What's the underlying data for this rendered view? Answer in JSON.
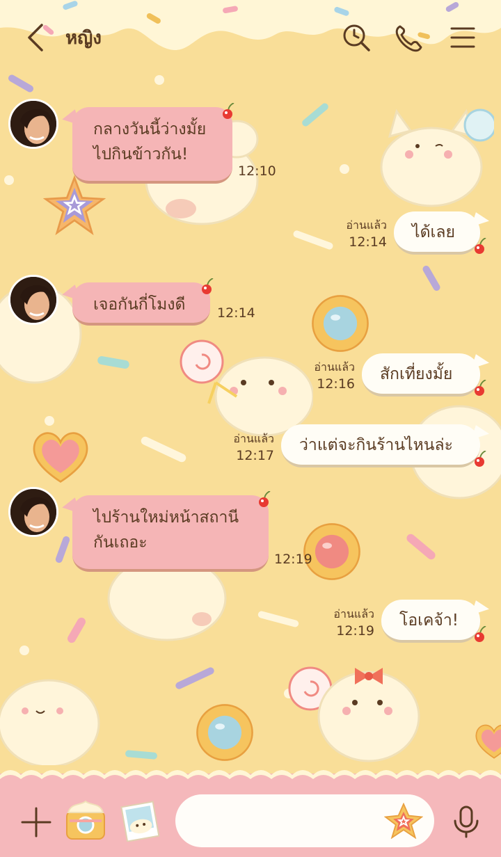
{
  "header": {
    "title": "หญิง"
  },
  "icons": {
    "back": "chevron-left-icon",
    "search": "search-clock-icon",
    "call": "phone-icon",
    "menu": "hamburger-menu-icon",
    "add": "plus-icon",
    "camera": "camera-icon",
    "gallery": "photo-icon",
    "sticker": "sticker-star-icon",
    "mic": "microphone-icon"
  },
  "colors": {
    "background": "#f9de98",
    "incoming_bubble": "#f5b5b6",
    "outgoing_bubble": "#fffdf6",
    "footer": "#f5b8bb",
    "text": "#5a3b22"
  },
  "messages": [
    {
      "from": "them",
      "lines": [
        "กลางวันนี้ว่างมั้ย",
        "ไปกินข้าวกัน!"
      ],
      "time": "12:10"
    },
    {
      "from": "me",
      "text": "ได้เลย",
      "read": "อ่านแล้ว",
      "time": "12:14"
    },
    {
      "from": "them",
      "lines": [
        "เจอกันกี่โมงดี"
      ],
      "time": "12:14"
    },
    {
      "from": "me",
      "text": "สักเที่ยงมั้ย",
      "read": "อ่านแล้ว",
      "time": "12:16"
    },
    {
      "from": "me",
      "text": "ว่าแต่จะกินร้านไหนล่ะ",
      "read": "อ่านแล้ว",
      "time": "12:17"
    },
    {
      "from": "them",
      "lines": [
        "ไปร้านใหม่หน้าสถานี",
        "กันเถอะ"
      ],
      "time": "12:19"
    },
    {
      "from": "me",
      "text": "โอเคจ้า!",
      "read": "อ่านแล้ว",
      "time": "12:19"
    }
  ],
  "composer": {
    "placeholder": ""
  }
}
